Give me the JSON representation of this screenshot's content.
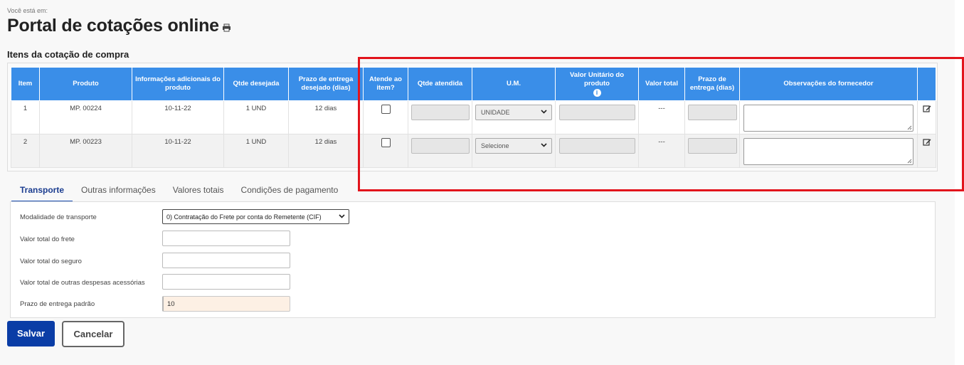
{
  "header": {
    "breadcrumb": "Você está em:",
    "title": "Portal de cotações online",
    "section_title": "Itens da cotação de compra"
  },
  "table": {
    "columns": [
      "Item",
      "Produto",
      "Informações adicionais do produto",
      "Qtde desejada",
      "Prazo de entrega desejado (dias)",
      "Atende ao item?",
      "Qtde atendida",
      "U.M.",
      "Valor Unitário do produto",
      "Valor total",
      "Prazo de entrega (dias)",
      "Observações do fornecedor",
      ""
    ],
    "rows": [
      {
        "item": "1",
        "produto": "MP. 00224",
        "info": "10-11-22",
        "qtde": "1 UND",
        "prazo": "12 dias",
        "um": "UNIDADE",
        "valor_total": "---"
      },
      {
        "item": "2",
        "produto": "MP. 00223",
        "info": "10-11-22",
        "qtde": "1 UND",
        "prazo": "12 dias",
        "um": "Selecione",
        "valor_total": "---"
      }
    ]
  },
  "tabs": [
    {
      "label": "Transporte",
      "active": true
    },
    {
      "label": "Outras informações",
      "active": false
    },
    {
      "label": "Valores totais",
      "active": false
    },
    {
      "label": "Condições de pagamento",
      "active": false
    }
  ],
  "transport": {
    "modalidade_label": "Modalidade de transporte",
    "modalidade_value": "0) Contratação do Frete por conta do Remetente (CIF)",
    "frete_label": "Valor total do frete",
    "frete_value": "",
    "seguro_label": "Valor total do seguro",
    "seguro_value": "",
    "outras_label": "Valor total de outras despesas acessórias",
    "outras_value": "",
    "prazo_label": "Prazo de entrega padrão",
    "prazo_value": "10"
  },
  "buttons": {
    "save": "Salvar",
    "cancel": "Cancelar"
  },
  "colors": {
    "table_header": "#3a8ee8",
    "primary_button": "#0a3da6",
    "highlight_box": "#e2141c"
  },
  "icons": {
    "print": "print-icon",
    "info": "info-icon",
    "edit": "edit-icon",
    "dropdown": "chevron-down-icon"
  }
}
